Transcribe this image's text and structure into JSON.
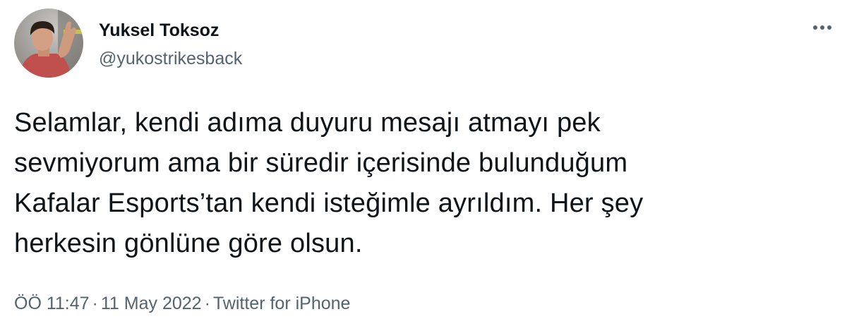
{
  "author": {
    "display_name": "Yuksel Toksoz",
    "handle": "@yukostrikesback"
  },
  "tweet": {
    "text": "Selamlar, kendi adıma duyuru mesajı atmayı pek\nsevmiyorum ama bir süredir içerisinde bulunduğum\nKafalar Esports’tan kendi isteğimle ayrıldım. Her şey\nherkesin gönlüne göre olsun."
  },
  "meta": {
    "time": "ÖÖ 11:47",
    "separator": "·",
    "date": "11 May 2022",
    "source": "Twitter for iPhone"
  },
  "icons": {
    "more": "more-horizontal-icon",
    "avatar": "profile-photo"
  },
  "colors": {
    "text_primary": "#0f1419",
    "text_secondary": "#536471",
    "background": "#ffffff"
  }
}
